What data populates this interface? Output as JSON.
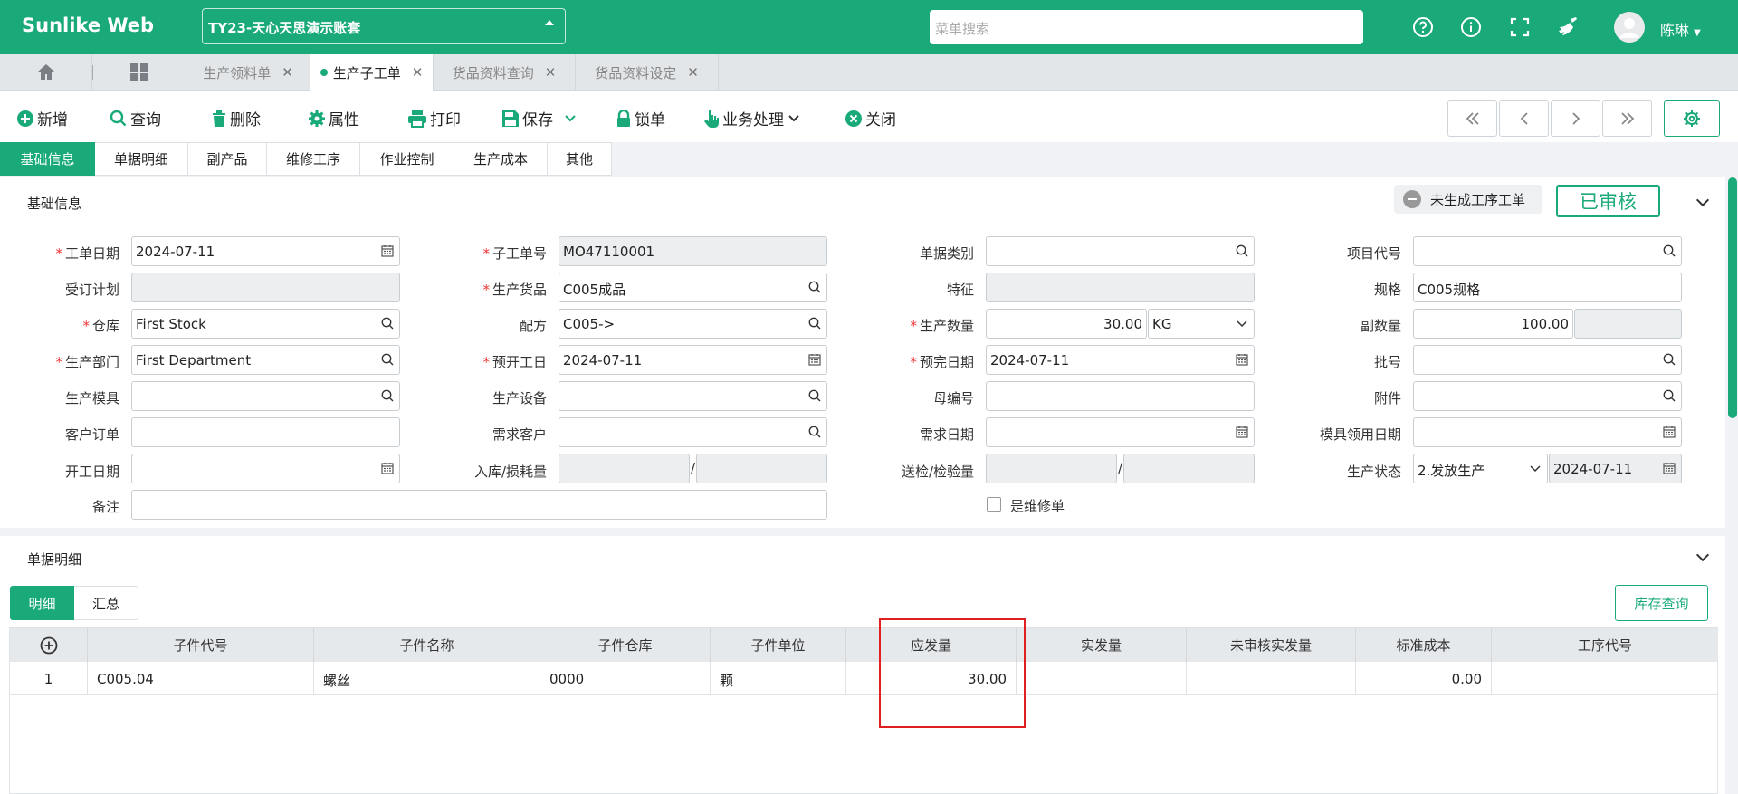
{
  "header": {
    "brand": "Sunlike Web",
    "account": "TY23-天心天思演示账套",
    "search_placeholder": "菜单搜索",
    "user_name": "陈琳"
  },
  "page_tabs": [
    {
      "label": "生产领料单",
      "active": false
    },
    {
      "label": "生产子工单",
      "active": true
    },
    {
      "label": "货品资料查询",
      "active": false
    },
    {
      "label": "货品资料设定",
      "active": false
    }
  ],
  "toolbar": {
    "new": "新增",
    "query": "查询",
    "delete": "删除",
    "props": "属性",
    "print": "打印",
    "save": "保存",
    "lock": "锁单",
    "business": "业务处理",
    "close": "关闭"
  },
  "section_tabs": [
    "基础信息",
    "单据明细",
    "副产品",
    "维修工序",
    "作业控制",
    "生产成本",
    "其他"
  ],
  "basic": {
    "title": "基础信息",
    "status_pending": "未生成工序工单",
    "status_audited": "已审核",
    "labels": {
      "order_date": "工单日期",
      "sub_no": "子工单号",
      "doc_type": "单据类别",
      "project_code": "项目代号",
      "plan": "受订计划",
      "product": "生产货品",
      "feature": "特征",
      "spec": "规格",
      "warehouse": "仓库",
      "formula": "配方",
      "qty": "生产数量",
      "sub_qty": "副数量",
      "dept": "生产部门",
      "start_plan": "预开工日",
      "end_plan": "预完日期",
      "batch": "批号",
      "mold": "生产模具",
      "equipment": "生产设备",
      "parent_no": "母编号",
      "attach": "附件",
      "cust_order": "客户订单",
      "demand_cust": "需求客户",
      "demand_date": "需求日期",
      "mold_date": "模具领用日期",
      "start_date": "开工日期",
      "in_loss": "入库/损耗量",
      "inspect": "送检/检验量",
      "prod_status": "生产状态",
      "remark": "备注",
      "repair": "是维修单"
    },
    "values": {
      "order_date": "2024-07-11",
      "sub_no": "MO47110001",
      "product": "C005成品",
      "spec": "C005规格",
      "warehouse": "First Stock",
      "formula": "C005->",
      "qty": "30.00",
      "unit": "KG",
      "sub_qty": "100.00",
      "dept": "First Department",
      "start_plan": "2024-07-11",
      "end_plan": "2024-07-11",
      "prod_status": "2.发放生产",
      "status_date": "2024-07-11"
    }
  },
  "detail": {
    "title": "单据明细",
    "tabs": [
      "明细",
      "汇总"
    ],
    "stock_query": "库存查询",
    "columns": [
      "子件代号",
      "子件名称",
      "子件仓库",
      "子件单位",
      "应发量",
      "实发量",
      "未审核实发量",
      "标准成本",
      "工序代号"
    ],
    "rows": [
      {
        "idx": "1",
        "code": "C005.04",
        "name": "螺丝",
        "wh": "0000",
        "unit": "颗",
        "due": "30.00",
        "actual": "",
        "unaudited": "",
        "cost": "0.00",
        "proc": ""
      }
    ]
  },
  "colors": {
    "accent": "#1aaa7a",
    "highlight": "#e02020"
  }
}
